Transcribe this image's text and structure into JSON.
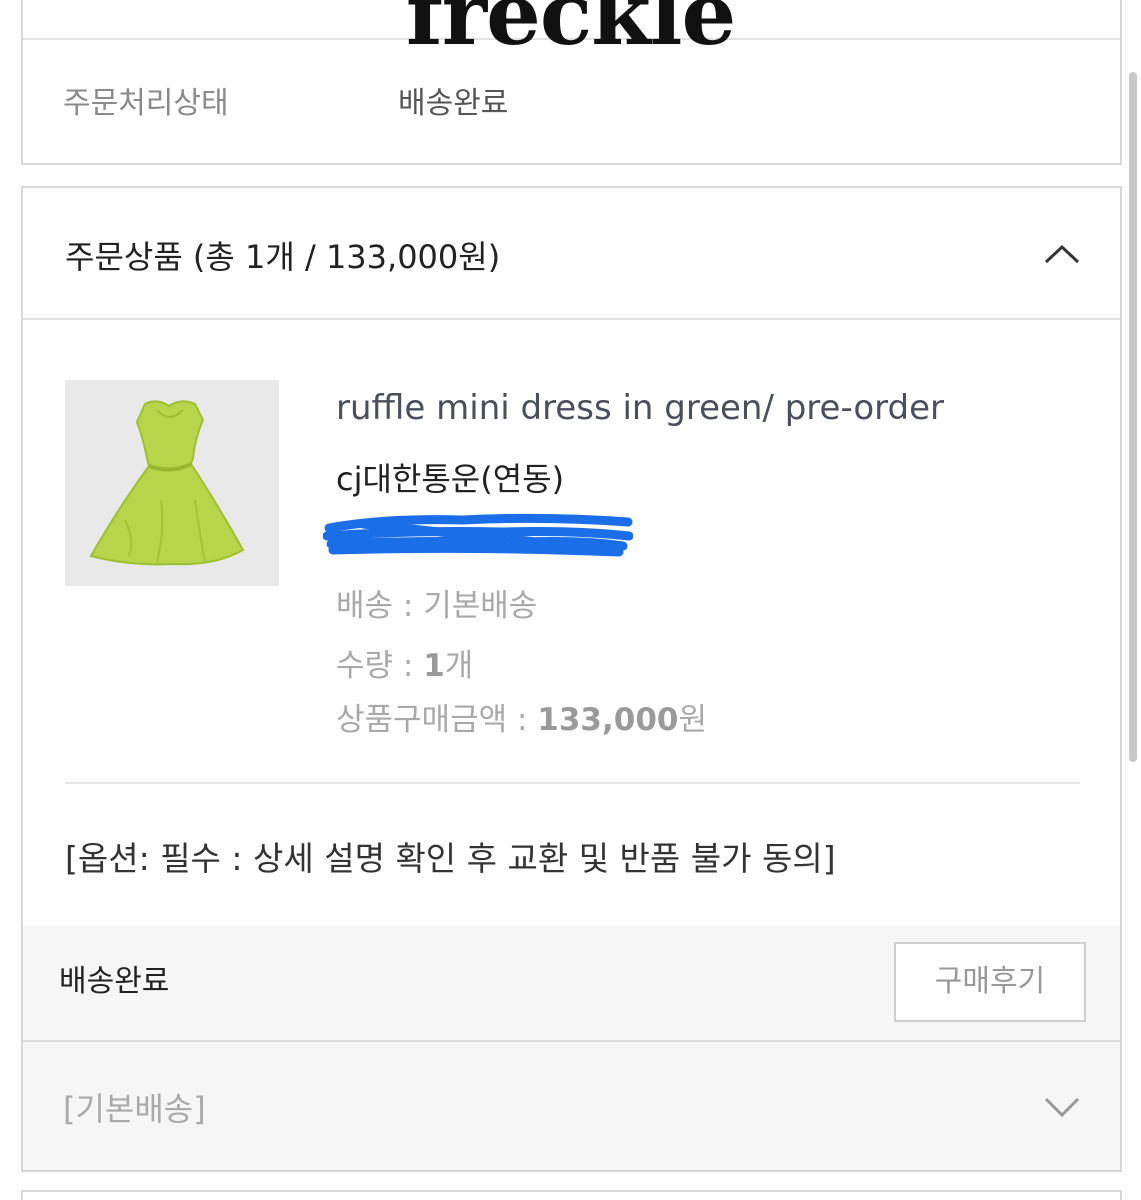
{
  "header": {
    "logo_text": "freckle"
  },
  "order_status": {
    "label": "주문처리상태",
    "value": "배송완료"
  },
  "order_items": {
    "title": "주문상품 (총 1개 / 133,000원)",
    "product": {
      "name": "ruffle mini dress in green/ pre-order",
      "courier": "cj대한통운(연동)",
      "shipping_label": "배송 : ",
      "shipping_value": "기본배송",
      "quantity_label": "수량 : ",
      "quantity_value": "1",
      "quantity_unit": "개",
      "price_label": "상품구매금액 : ",
      "price_value": "133,000",
      "price_unit": "원",
      "option": "[옵션: 필수 : 상세 설명 확인 후 교환 및 반품 불가 동의]"
    },
    "delivery_status": "배송완료",
    "review_button": "구매후기",
    "shipping_group": "[기본배송]"
  },
  "colors": {
    "dress_green": "#b8d44a",
    "redaction_blue": "#1a6ee8",
    "border": "#d8d8d8"
  },
  "icons": {
    "collapse": "chevron-up-icon",
    "expand": "chevron-down-icon"
  }
}
